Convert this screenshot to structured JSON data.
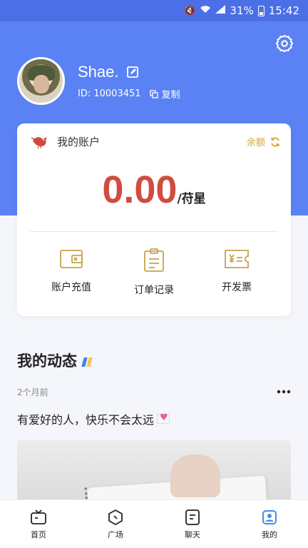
{
  "status_bar": {
    "battery": "31%",
    "time": "15:42"
  },
  "profile": {
    "name": "Shae.",
    "id_text": "ID: 10003451",
    "copy_label": "复制"
  },
  "account": {
    "title": "我的账户",
    "balance_link": "余额",
    "amount": "0.00",
    "unit": "/苻星",
    "actions": [
      {
        "label": "账户充值",
        "icon": "wallet-icon"
      },
      {
        "label": "订单记录",
        "icon": "clipboard-icon"
      },
      {
        "label": "开发票",
        "icon": "invoice-icon"
      }
    ]
  },
  "feed": {
    "title": "我的动态",
    "post": {
      "time": "2个月前",
      "text": "有爱好的人，快乐不会太远"
    }
  },
  "tabs": [
    {
      "label": "首页",
      "icon": "tv-icon",
      "active": false
    },
    {
      "label": "广场",
      "icon": "compass-icon",
      "active": false
    },
    {
      "label": "聊天",
      "icon": "chat-icon",
      "active": false
    },
    {
      "label": "我的",
      "icon": "user-icon",
      "active": true
    }
  ],
  "colors": {
    "header": "#5b82f4",
    "accent": "#d24b3f",
    "gold": "#d9a531",
    "tab_active": "#3f8fe8"
  }
}
